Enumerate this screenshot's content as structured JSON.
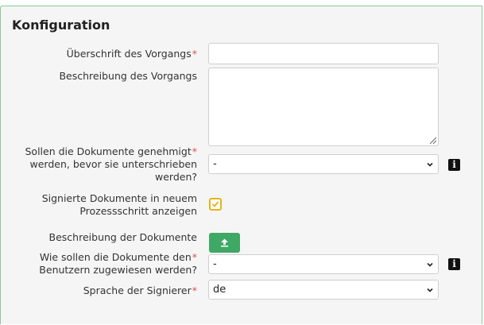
{
  "panel": {
    "title": "Konfiguration"
  },
  "fields": {
    "heading": {
      "label": "Überschrift des Vorgangs",
      "required": "*",
      "value": ""
    },
    "description": {
      "label": "Beschreibung des Vorgangs",
      "value": ""
    },
    "approval": {
      "label_lines": [
        "Sollen die Dokumente genehmigt",
        "werden, bevor sie unterschrieben",
        "werden?"
      ],
      "required": "*",
      "value": "-"
    },
    "show_signed": {
      "label_lines": [
        "Signierte Dokumente in neuem",
        "Prozessschritt anzeigen"
      ],
      "checked": true
    },
    "doc_description": {
      "label": "Beschreibung der Dokumente"
    },
    "assignment": {
      "label_lines": [
        "Wie sollen die Dokumente den",
        "Benutzern zugewiesen werden?"
      ],
      "required": "*",
      "value": "-"
    },
    "signer_language": {
      "label": "Sprache der Signierer",
      "required": "*",
      "value": "de"
    }
  },
  "icons": {
    "info": "info-icon",
    "upload": "upload-arrow-icon",
    "check": "check-icon",
    "chevron": "chevron-down-icon"
  },
  "colors": {
    "accent_green": "#3fa865",
    "required_red": "#d9534f",
    "checkbox_yellow": "#e7b21a",
    "panel_border": "#8fc79a"
  }
}
